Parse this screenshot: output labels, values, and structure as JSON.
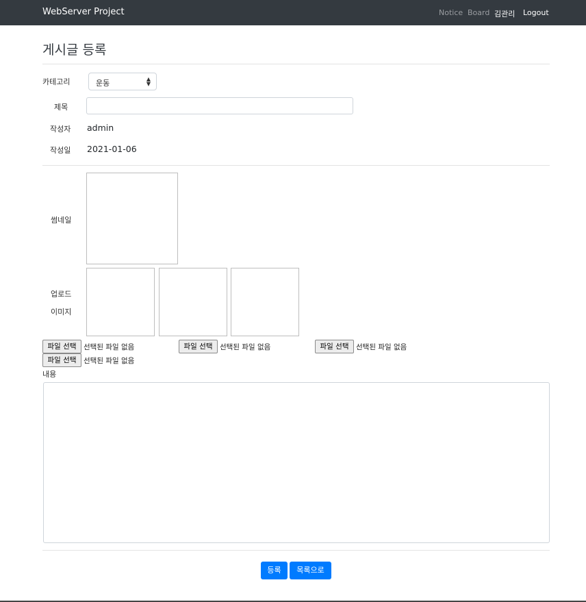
{
  "navbar": {
    "brand": "WebServer Project",
    "links": [
      {
        "label": "Notice"
      },
      {
        "label": "Board"
      },
      {
        "label": "김관리"
      },
      {
        "label": "Logout"
      }
    ]
  },
  "page": {
    "title": "게시글 등록"
  },
  "form": {
    "category": {
      "label": "카테고리",
      "selected": "운동"
    },
    "title": {
      "label": "제목",
      "value": "",
      "placeholder": ""
    },
    "author": {
      "label": "작성자",
      "value": "admin"
    },
    "date": {
      "label": "작성일",
      "value": "2021-01-06"
    },
    "thumbnail": {
      "label": "썸네일"
    },
    "upload": {
      "label_line1": "업로드",
      "label_line2": "이미지"
    },
    "file_inputs": [
      {
        "button": "파일 선택",
        "status": "선택된 파일 없음"
      },
      {
        "button": "파일 선택",
        "status": "선택된 파일 없음"
      },
      {
        "button": "파일 선택",
        "status": "선택된 파일 없음"
      },
      {
        "button": "파일 선택",
        "status": "선택된 파일 없음"
      }
    ],
    "content": {
      "label": "내용",
      "value": ""
    }
  },
  "actions": {
    "submit": "등록",
    "list": "목록으로"
  },
  "colors": {
    "navbar": "#343a40",
    "primary": "#007bff"
  }
}
